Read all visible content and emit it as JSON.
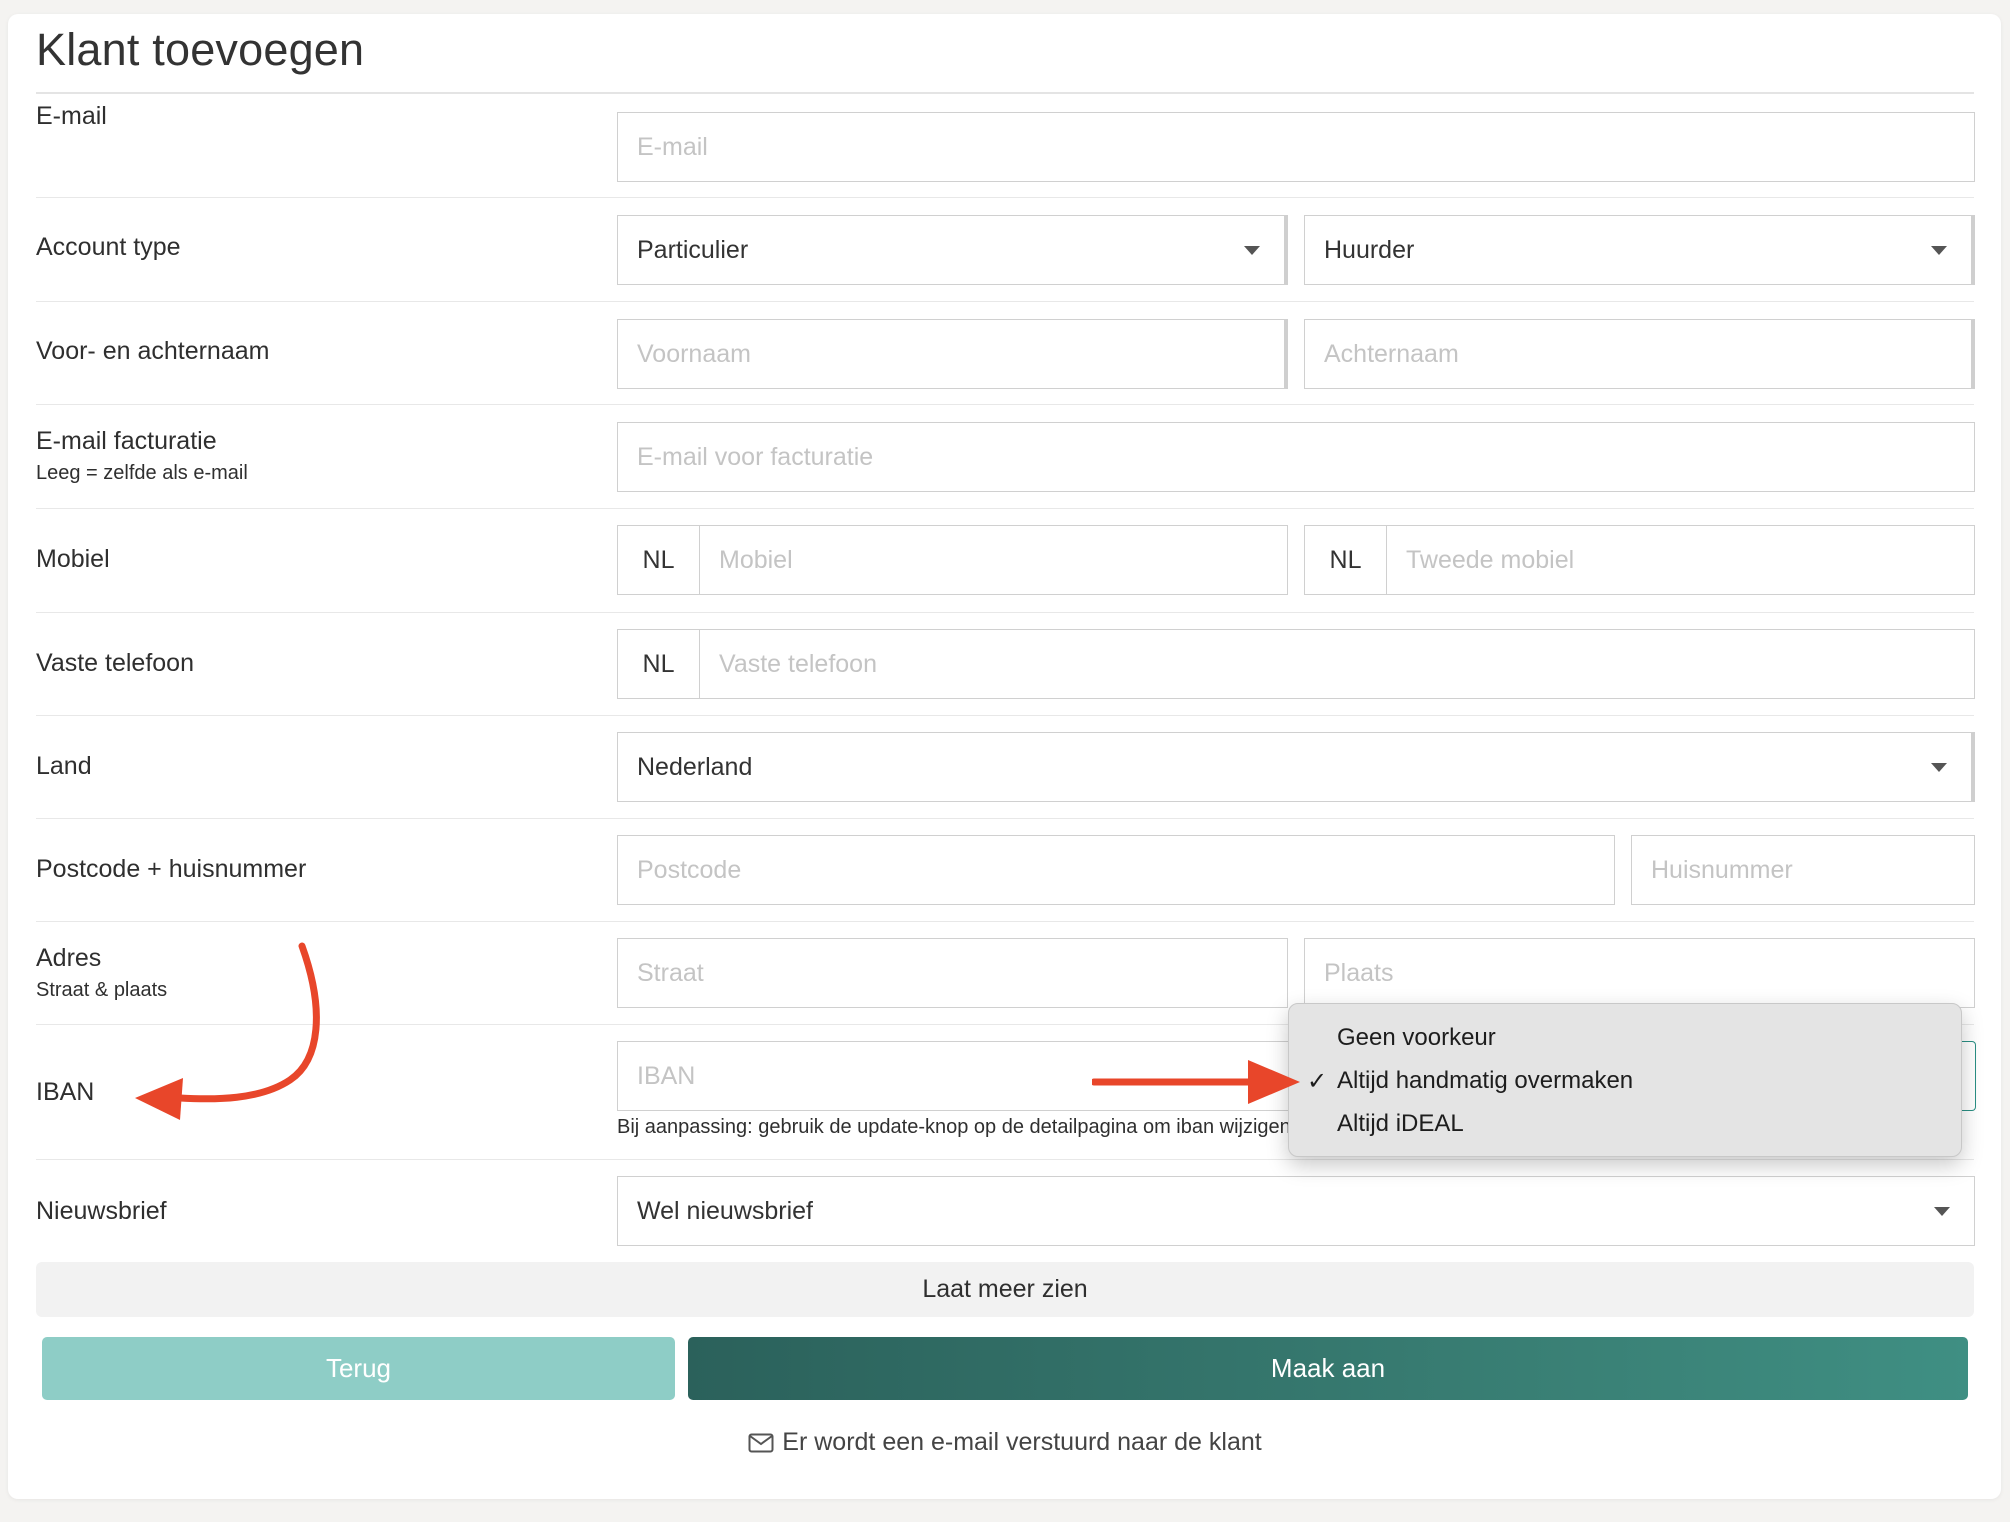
{
  "page": {
    "title": "Klant toevoegen"
  },
  "form": {
    "email": {
      "label": "E-mail",
      "placeholder": "E-mail"
    },
    "account_type": {
      "label": "Account type",
      "type_value": "Particulier",
      "role_value": "Huurder"
    },
    "name": {
      "label": "Voor- en achternaam",
      "first_placeholder": "Voornaam",
      "last_placeholder": "Achternaam"
    },
    "billing_email": {
      "label": "E-mail facturatie",
      "sublabel": "Leeg = zelfde als e-mail",
      "placeholder": "E-mail voor facturatie"
    },
    "mobile": {
      "label": "Mobiel",
      "country_code": "NL",
      "placeholder": "Mobiel",
      "second_country_code": "NL",
      "second_placeholder": "Tweede mobiel"
    },
    "landline": {
      "label": "Vaste telefoon",
      "country_code": "NL",
      "placeholder": "Vaste telefoon"
    },
    "country": {
      "label": "Land",
      "value": "Nederland"
    },
    "postcode": {
      "label": "Postcode + huisnummer",
      "postcode_placeholder": "Postcode",
      "house_placeholder": "Huisnummer"
    },
    "address": {
      "label": "Adres",
      "sublabel": "Straat & plaats",
      "street_placeholder": "Straat",
      "city_placeholder": "Plaats"
    },
    "iban": {
      "label": "IBAN",
      "placeholder": "IBAN",
      "help": "Bij aanpassing: gebruik de update-knop op de detailpagina om iban wijzigen"
    },
    "newsletter": {
      "label": "Nieuwsbrief",
      "value": "Wel nieuwsbrief"
    }
  },
  "payment_dropdown": {
    "options": [
      "Geen voorkeur",
      "Altijd handmatig overmaken",
      "Altijd iDEAL"
    ],
    "selected_index": 1,
    "check_glyph": "✓"
  },
  "actions": {
    "show_more": "Laat meer zien",
    "back": "Terug",
    "create": "Maak aan",
    "email_notice": "Er wordt een e-mail verstuurd naar de klant"
  },
  "colors": {
    "back_button": "#8ecdc6",
    "create_button": "#2f6b64",
    "annotation_arrow": "#e8462a"
  },
  "icons": {
    "notice_icon": "envelope-icon",
    "select_caret": "caret-down-icon"
  }
}
